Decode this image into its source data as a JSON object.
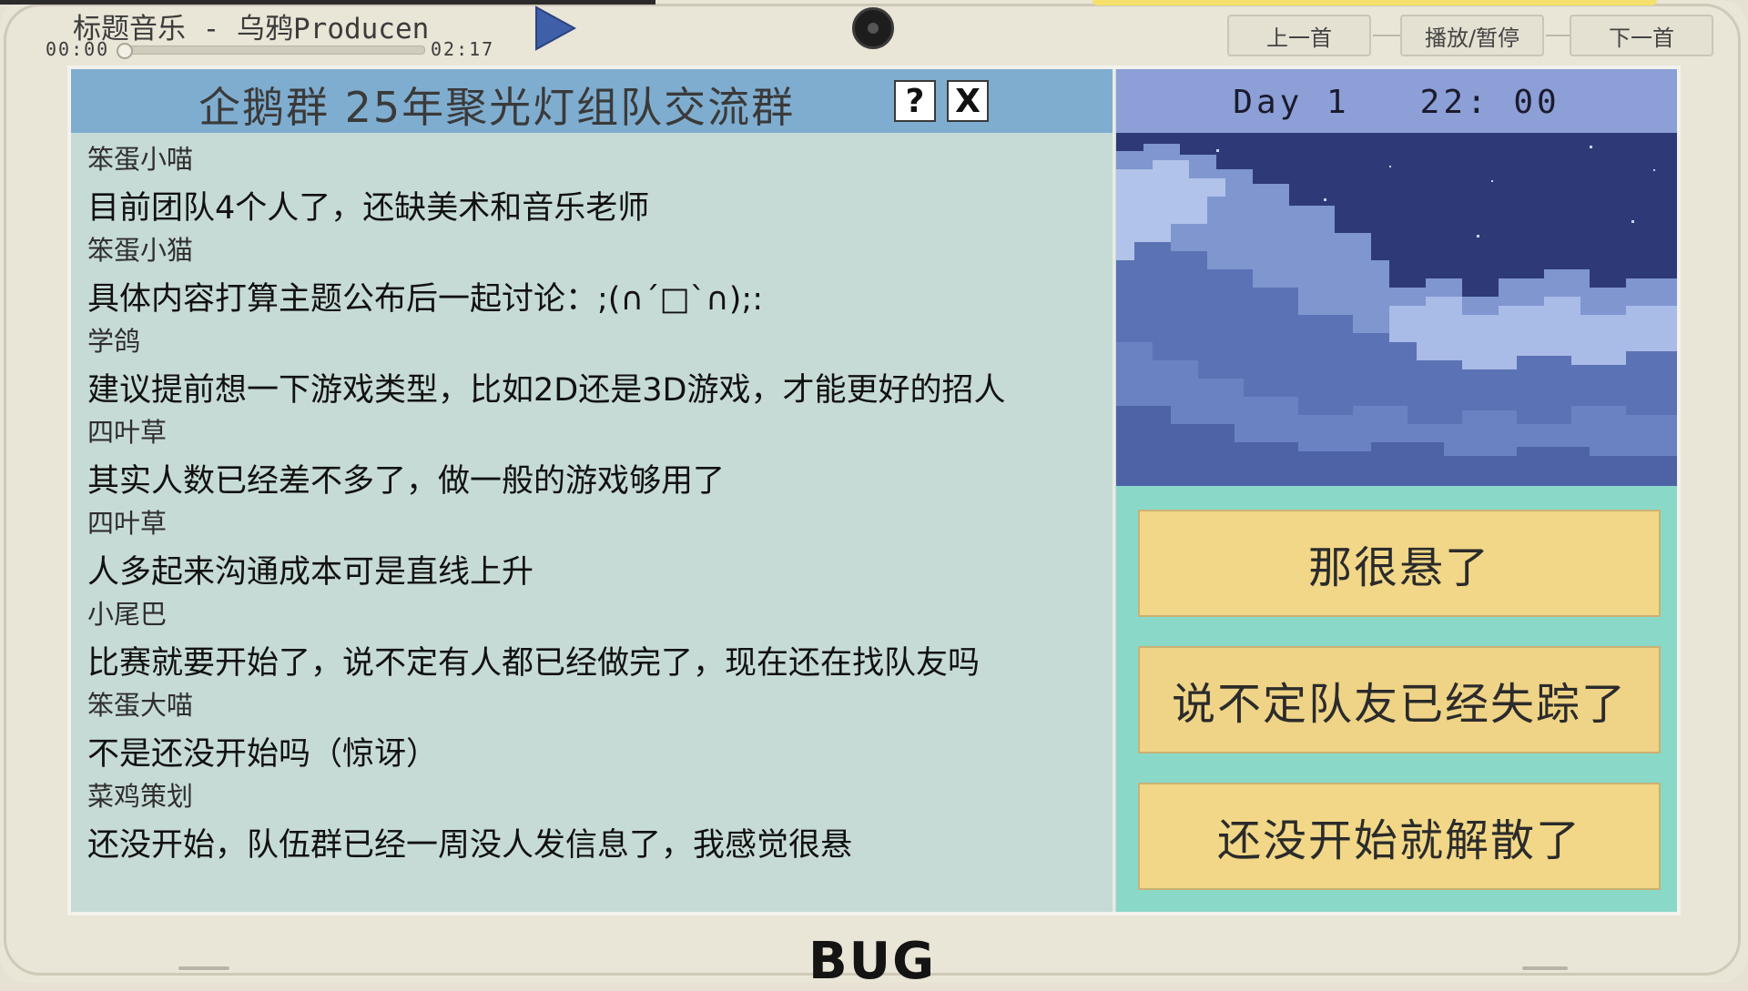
{
  "player": {
    "track": "标题音乐 - 乌鸦Producen",
    "time_elapsed": "00:00",
    "time_total": "02:17",
    "progress": 0.0,
    "play_icon": "play-triangle-icon",
    "prev_label": "上一首",
    "playpause_label": "播放/暂停",
    "next_label": "下一首"
  },
  "chat": {
    "title": "企鹅群  25年聚光灯组队交流群",
    "help_label": "?",
    "close_label": "X",
    "messages": [
      {
        "sender": "笨蛋小喵",
        "text": "目前团队4个人了，还缺美术和音乐老师"
      },
      {
        "sender": "笨蛋小猫",
        "text": "具体内容打算主题公布后一起讨论：;(∩´□`∩);:"
      },
      {
        "sender": "学鸽",
        "text": "建议提前想一下游戏类型，比如2D还是3D游戏，才能更好的招人"
      },
      {
        "sender": "四叶草",
        "text": "其实人数已经差不多了，做一般的游戏够用了"
      },
      {
        "sender": "四叶草",
        "text": "人多起来沟通成本可是直线上升"
      },
      {
        "sender": "小尾巴",
        "text": "比赛就要开始了，说不定有人都已经做完了，现在还在找队友吗"
      },
      {
        "sender": "笨蛋大喵",
        "text": "不是还没开始吗（惊讶）"
      },
      {
        "sender": "菜鸡策划",
        "text": "还没开始，队伍群已经一周没人发信息了，我感觉很悬"
      }
    ]
  },
  "status": {
    "day_time": "Day 1   22: 00"
  },
  "choices": [
    {
      "label": "那很悬了"
    },
    {
      "label": "说不定队友已经失踪了"
    },
    {
      "label": "还没开始就解散了"
    }
  ],
  "brand": "BUG",
  "colors": {
    "frame": "#e9e5d7",
    "chat_header": "#7fadcf",
    "chat_bg": "#c7dbd6",
    "status_bar": "#8c9fd6",
    "choice_area": "#8ad8c8",
    "choice_button": "#f1d787"
  }
}
